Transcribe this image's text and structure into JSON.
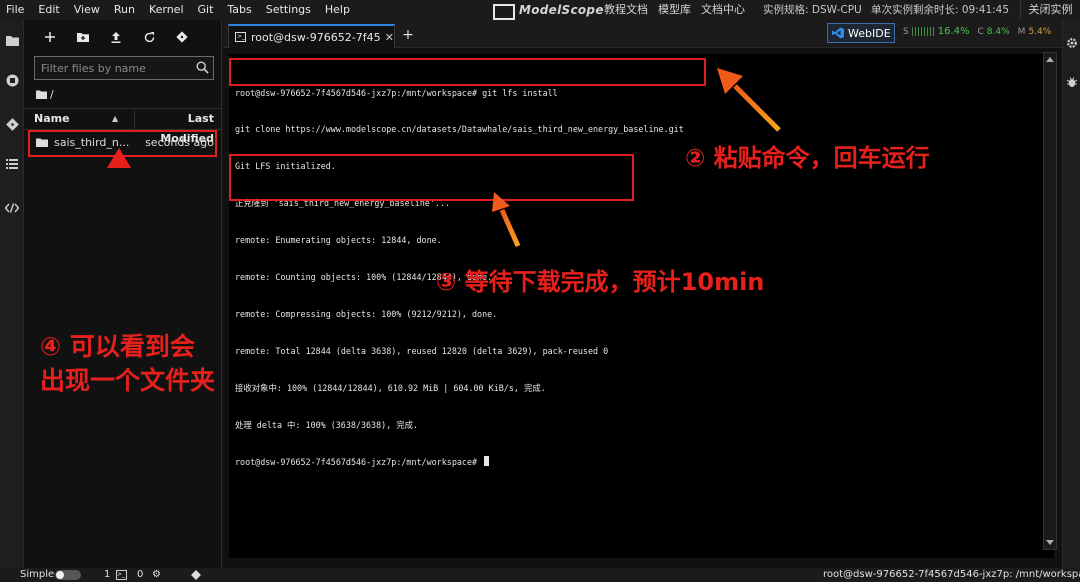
{
  "menubar": {
    "items": [
      "File",
      "Edit",
      "View",
      "Run",
      "Kernel",
      "Git",
      "Tabs",
      "Settings",
      "Help"
    ],
    "brand": "ModelScope",
    "links": [
      "教程文档",
      "模型库",
      "文档中心"
    ],
    "spec": "实例规格: DSW-CPU",
    "remaining": "单次实例剩余时长: 09:41:45",
    "close_instance": "关闭实例"
  },
  "file_browser": {
    "filter_placeholder": "Filter files by name",
    "breadcrumb": "/",
    "col_name": "Name",
    "col_modified": "Last Modified",
    "rows": [
      {
        "name": "sais_third_n...",
        "modified": "seconds ago"
      }
    ]
  },
  "tabs": {
    "terminal_tab": "root@dsw-976652-7f4567d5",
    "webide": "WebIDE",
    "monitor": {
      "s_label": "S",
      "s_value": "16.4%",
      "c_label": "C",
      "c_value": "8.4%",
      "m_label": "M",
      "m_value": "5.4%"
    }
  },
  "terminal": {
    "lines": [
      "root@dsw-976652-7f4567d546-jxz7p:/mnt/workspace# git lfs install",
      "git clone https://www.modelscope.cn/datasets/Datawhale/sais_third_new_energy_baseline.git",
      "Git LFS initialized.",
      "正克隆到 'sais_third_new_energy_baseline'...",
      "remote: Enumerating objects: 12844, done.",
      "remote: Counting objects: 100% (12844/12844), done.",
      "remote: Compressing objects: 100% (9212/9212), done.",
      "remote: Total 12844 (delta 3638), reused 12820 (delta 3629), pack-reused 0",
      "接收对象中: 100% (12844/12844), 610.92 MiB | 604.00 KiB/s, 完成.",
      "处理 delta 中: 100% (3638/3638), 完成.",
      "root@dsw-976652-7f4567d546-jxz7p:/mnt/workspace# "
    ]
  },
  "statusbar": {
    "mode": "Simple",
    "count1": "1",
    "count2": "0",
    "path": "root@dsw-976652-7f4567d546-jxz7p: /mnt/workspace"
  },
  "annotations": {
    "step2": "② 粘贴命令，回车运行",
    "step3": "③ 等待下载完成，预计10min",
    "step4_line1": "④ 可以看到会",
    "step4_line2": "出现一个文件夹",
    "color": "#e8201c"
  },
  "icons": [
    "folder-icon",
    "running-icon",
    "git-icon",
    "toc-icon",
    "code-icon",
    "new-folder-icon",
    "upload-icon",
    "refresh-icon",
    "git-clone-icon",
    "search-icon",
    "terminal-icon",
    "vscode-icon",
    "gear-icon",
    "bug-icon"
  ]
}
